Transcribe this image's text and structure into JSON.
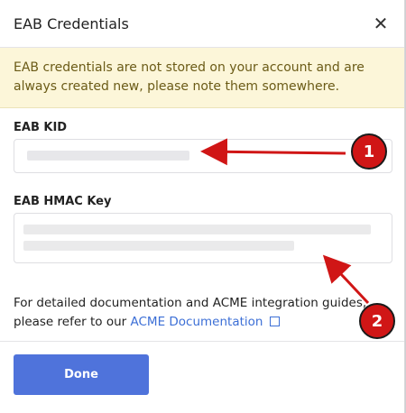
{
  "dialog": {
    "title": "EAB Credentials",
    "close_icon": "close-icon",
    "notice": "EAB credentials are not stored on your account and are always created new, please note them somewhere."
  },
  "fields": {
    "kid_label": "EAB KID",
    "hmac_label": "EAB HMAC Key"
  },
  "footer": {
    "note_text": "For detailed documentation and ACME integration guides, please refer to our ",
    "link_text": "ACME Documentation",
    "link_icon": "external-link-icon"
  },
  "actions": {
    "done_label": "Done"
  },
  "annotations": {
    "badge_1": "1",
    "badge_2": "2",
    "color": "#d01616"
  }
}
